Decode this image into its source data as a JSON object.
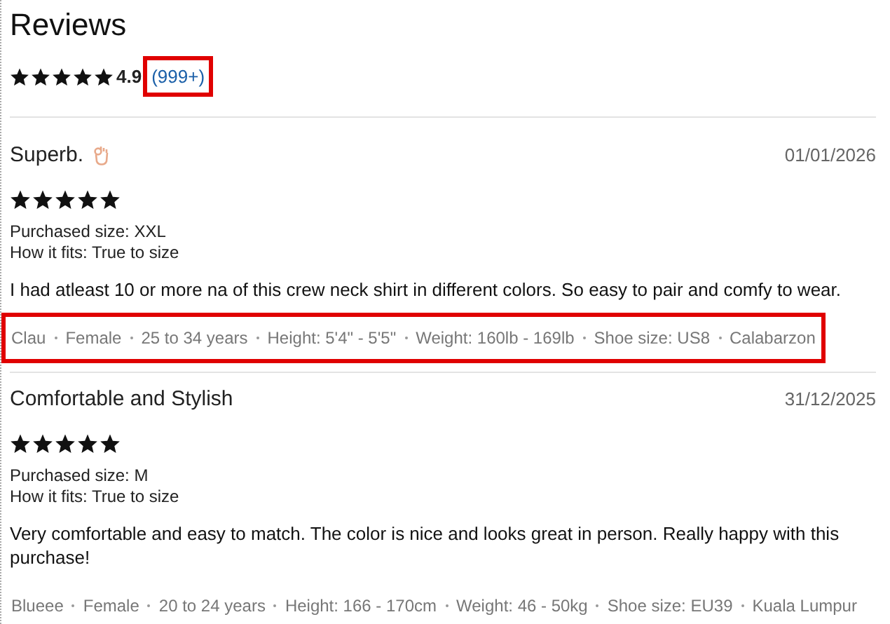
{
  "title": "Reviews",
  "summary": {
    "stars": 5,
    "score": "4.9",
    "count": "(999+)",
    "highlighted": true
  },
  "reviews": [
    {
      "title": "Superb.",
      "emoji": true,
      "date": "01/01/2026",
      "stars": 5,
      "size": "Purchased size: XXL",
      "fit": "How it fits: True to size",
      "body": "I had atleast 10 or more na of this crew neck shirt in different colors. So easy to pair and comfy to wear.",
      "meta": [
        "Clau",
        "Female",
        "25 to 34 years",
        "Height: 5'4\" - 5'5\"",
        "Weight: 160lb - 169lb",
        "Shoe size: US8",
        "Calabarzon"
      ],
      "highlighted": true
    },
    {
      "title": "Comfortable and Stylish",
      "date": "31/12/2025",
      "stars": 5,
      "size": "Purchased size: M",
      "fit": "How it fits: True to size",
      "body": "Very comfortable and easy to match. The color is nice and looks great in person. Really happy with this purchase!",
      "meta": [
        "Blueee",
        "Female",
        "20 to 24 years",
        "Height: 166 - 170cm",
        "Weight: 46 - 50kg",
        "Shoe size: EU39",
        "Kuala Lumpur"
      ],
      "highlighted": false
    }
  ]
}
